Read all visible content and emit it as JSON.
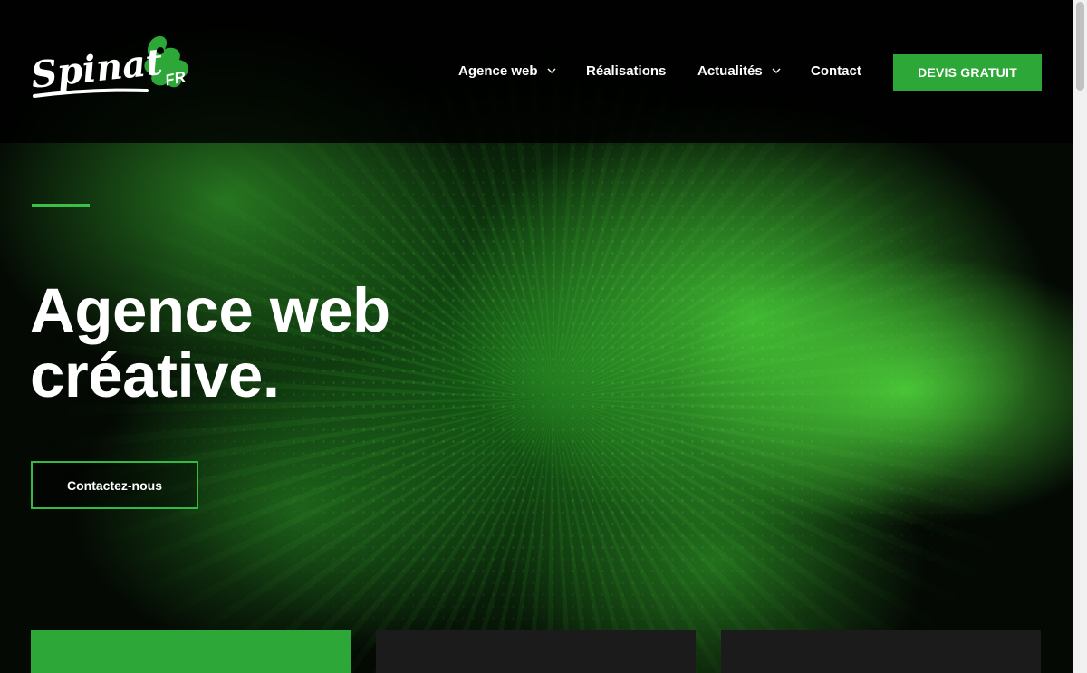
{
  "logo": {
    "name": "Spinat",
    "suffix": "FR"
  },
  "nav": {
    "items": [
      {
        "label": "Agence web",
        "has_dropdown": true
      },
      {
        "label": "Réalisations",
        "has_dropdown": false
      },
      {
        "label": "Actualités",
        "has_dropdown": true
      },
      {
        "label": "Contact",
        "has_dropdown": false
      }
    ],
    "cta_label": "DEVIS GRATUIT"
  },
  "hero": {
    "title_line1": "Agence web",
    "title_line2": "créative.",
    "button_label": "Contactez-nous"
  },
  "colors": {
    "accent_green": "#2da838",
    "header_bg": "#000000",
    "card_dark": "#1b1b1b",
    "text": "#ffffff"
  },
  "icons": {
    "dropdown": "chevron-down-icon"
  }
}
